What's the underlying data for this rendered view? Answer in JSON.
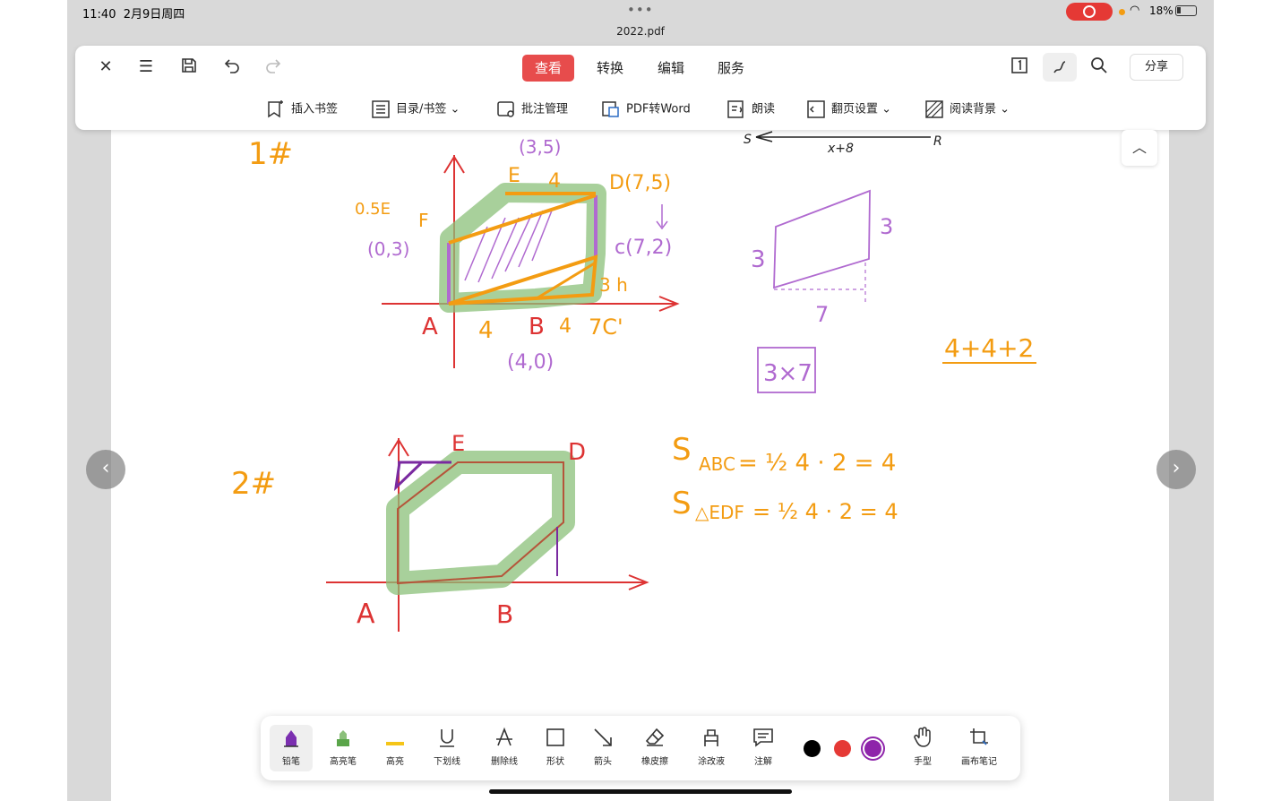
{
  "status": {
    "time": "11:40",
    "date": "2月9日周四",
    "file": "2022.pdf",
    "battery": "18%"
  },
  "toolbar": {
    "tabs": [
      "查看",
      "转换",
      "编辑",
      "服务"
    ],
    "active_tab": "查看",
    "share": "分享",
    "sub_items": [
      "插入书签",
      "目录/书签",
      "批注管理",
      "PDF转Word",
      "朗读",
      "翻页设置",
      "阅读背景"
    ]
  },
  "page": {
    "labels": {
      "one": "1#",
      "two": "2#",
      "p35": "(3,5)",
      "e1": "E",
      "four_top": "4",
      "d75": "D(7,5)",
      "e05": "0.5E",
      "f1": "F",
      "p03": "(0,3)",
      "c72": "c(7,2)",
      "h": "3 h",
      "a1": "A",
      "four1": "4",
      "b1": "B",
      "four2": "4",
      "seven_c": "7C'",
      "p40": "(4,0)",
      "s": "S",
      "r": "R",
      "x8": "x+8",
      "three_l": "3",
      "three_r": "3",
      "seven": "7",
      "box": "3×7",
      "sum": "4+4+2",
      "e2": "E",
      "d2": "D",
      "a2": "A",
      "b2": "B",
      "sabc": "S",
      "sabc_sub": "ABC",
      "sabc_eq": "= ½ 4 · 2  = 4",
      "sedf": "S",
      "sedf_sub": "△EDF",
      "sedf_eq": "= ½ 4 · 2 = 4"
    }
  },
  "pen_tools": [
    "铅笔",
    "高亮笔",
    "高亮",
    "下划线",
    "删除线",
    "形状",
    "箭头",
    "橡皮擦",
    "涂改液",
    "注解",
    "手型",
    "画布笔记"
  ],
  "colors": {
    "orange": "#f39c12",
    "purple": "#b06ad0",
    "green": "#8bc07a",
    "red": "#e74c4c",
    "swatch_black": "#000000",
    "swatch_red": "#e53935",
    "swatch_purple": "#8e24aa"
  },
  "icons": [
    "close-icon",
    "menu-icon",
    "save-icon",
    "undo-icon",
    "redo-icon",
    "page-icon",
    "pen-mode-icon",
    "search-icon",
    "chevron-left-icon",
    "chevron-right-icon",
    "chevron-up-icon"
  ]
}
